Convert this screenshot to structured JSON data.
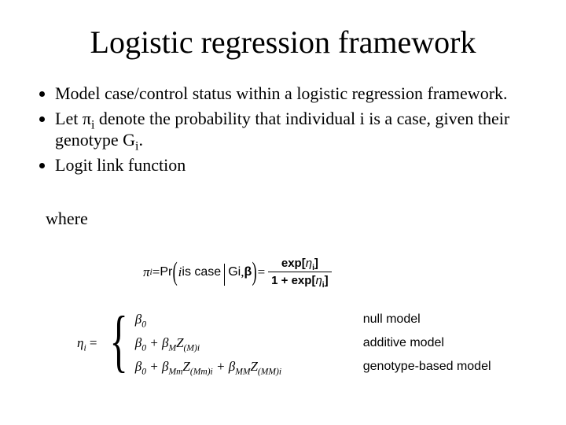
{
  "title": "Logistic regression framework",
  "bullets": {
    "b1": "Model case/control status within a logistic regression framework.",
    "b2_pre": "Let π",
    "b2_sub": "i",
    "b2_post": " denote the probability that individual i is a case, given their genotype G",
    "b2_sub2": "i",
    "b2_post2": ".",
    "b3": "Logit link function"
  },
  "where": "where",
  "eq": {
    "pi": "π",
    "pi_sub": "i",
    "eq_sign": " = ",
    "pr": "Pr",
    "inner_pre": "i ",
    "inner_sans": "is case",
    "G": "G",
    "G_sub": "i",
    "comma": " , ",
    "beta": "β",
    "eq2": " = ",
    "exp": "exp",
    "lb": "[",
    "eta": "η",
    "eta_sub": "i",
    "rb": "]",
    "one_plus": "1 + "
  },
  "cases": {
    "eta": "η",
    "eta_sub": "i",
    "eq": " = ",
    "row1_formula": "β₀",
    "row1_label": "null model",
    "row2_b0": "β",
    "row2_b0s": "0",
    "row2_plus": " + ",
    "row2_bM": "β",
    "row2_bMs": "M",
    "row2_Z": "Z",
    "row2_Zs": "(M)i",
    "row2_label": "additive model",
    "row3_b0": "β",
    "row3_b0s": "0",
    "row3_p1": " + ",
    "row3_bMm": "β",
    "row3_bMms": "Mm",
    "row3_Z1": "Z",
    "row3_Z1s": "(Mm)i",
    "row3_p2": " + ",
    "row3_bMM": "β",
    "row3_bMMs": "MM",
    "row3_Z2": "Z",
    "row3_Z2s": "(MM)i",
    "row3_label": "genotype-based model"
  }
}
